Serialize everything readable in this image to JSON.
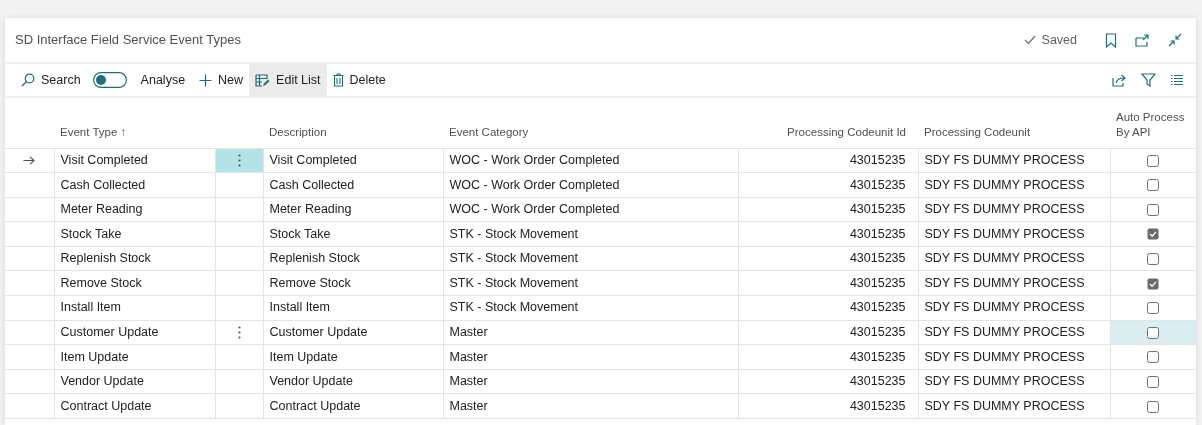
{
  "page": {
    "title": "SD Interface Field Service Event Types",
    "save_status": "Saved"
  },
  "toolbar": [
    {
      "kind": "search",
      "label": "Search",
      "selected": false
    },
    {
      "kind": "toggle",
      "label": "Analyse",
      "on": false,
      "selected": false
    },
    {
      "kind": "new",
      "label": "New",
      "selected": false
    },
    {
      "kind": "edit",
      "label": "Edit List",
      "selected": true
    },
    {
      "kind": "delete",
      "label": "Delete",
      "selected": false
    }
  ],
  "table": {
    "columns": [
      "Event Type ↑",
      "Description",
      "Event Category",
      "Processing Codeunit Id",
      "Processing Codeunit",
      "Auto Process By API"
    ],
    "rows": [
      {
        "event_type": "Visit Completed",
        "description": "Visit Completed",
        "event_category": "WOC - Work Order Completed",
        "codeunit_id": "43015235",
        "codeunit": "SDY FS DUMMY PROCESS",
        "auto_process": false,
        "selected": true,
        "hovered": false
      },
      {
        "event_type": "Cash Collected",
        "description": "Cash Collected",
        "event_category": "WOC - Work Order Completed",
        "codeunit_id": "43015235",
        "codeunit": "SDY FS DUMMY PROCESS",
        "auto_process": false,
        "selected": false,
        "hovered": false
      },
      {
        "event_type": "Meter Reading",
        "description": "Meter Reading",
        "event_category": "WOC - Work Order Completed",
        "codeunit_id": "43015235",
        "codeunit": "SDY FS DUMMY PROCESS",
        "auto_process": false,
        "selected": false,
        "hovered": false
      },
      {
        "event_type": "Stock Take",
        "description": "Stock Take",
        "event_category": "STK - Stock Movement",
        "codeunit_id": "43015235",
        "codeunit": "SDY FS DUMMY PROCESS",
        "auto_process": true,
        "selected": false,
        "hovered": false
      },
      {
        "event_type": "Replenish Stock",
        "description": "Replenish Stock",
        "event_category": "STK - Stock Movement",
        "codeunit_id": "43015235",
        "codeunit": "SDY FS DUMMY PROCESS",
        "auto_process": false,
        "selected": false,
        "hovered": false
      },
      {
        "event_type": "Remove Stock",
        "description": "Remove Stock",
        "event_category": "STK - Stock Movement",
        "codeunit_id": "43015235",
        "codeunit": "SDY FS DUMMY PROCESS",
        "auto_process": true,
        "selected": false,
        "hovered": false
      },
      {
        "event_type": "Install Item",
        "description": "Install Item",
        "event_category": "STK - Stock Movement",
        "codeunit_id": "43015235",
        "codeunit": "SDY FS DUMMY PROCESS",
        "auto_process": false,
        "selected": false,
        "hovered": false
      },
      {
        "event_type": "Customer Update",
        "description": "Customer Update",
        "event_category": "Master",
        "codeunit_id": "43015235",
        "codeunit": "SDY FS DUMMY PROCESS",
        "auto_process": false,
        "selected": false,
        "hovered": true
      },
      {
        "event_type": "Item Update",
        "description": "Item Update",
        "event_category": "Master",
        "codeunit_id": "43015235",
        "codeunit": "SDY FS DUMMY PROCESS",
        "auto_process": false,
        "selected": false,
        "hovered": false
      },
      {
        "event_type": "Vendor Update",
        "description": "Vendor Update",
        "event_category": "Master",
        "codeunit_id": "43015235",
        "codeunit": "SDY FS DUMMY PROCESS",
        "auto_process": false,
        "selected": false,
        "hovered": false
      },
      {
        "event_type": "Contract Update",
        "description": "Contract Update",
        "event_category": "Master",
        "codeunit_id": "43015235",
        "codeunit": "SDY FS DUMMY PROCESS",
        "auto_process": false,
        "selected": false,
        "hovered": false
      }
    ]
  }
}
